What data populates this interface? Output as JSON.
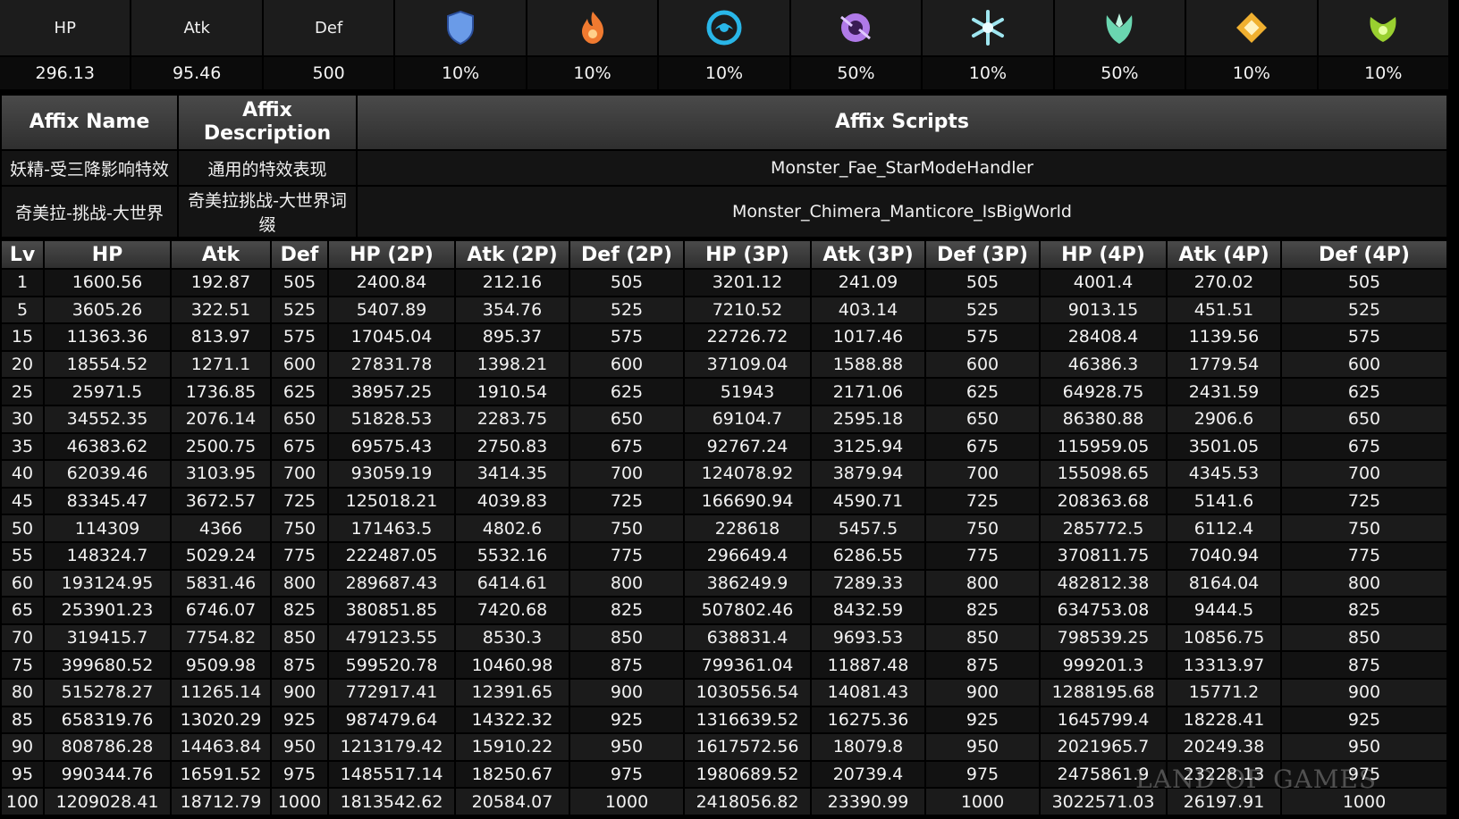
{
  "stats": [
    {
      "label": "HP",
      "value": "296.13"
    },
    {
      "label": "Atk",
      "value": "95.46"
    },
    {
      "label": "Def",
      "value": "500"
    },
    {
      "icon": "physical-shield-icon",
      "value": "10%",
      "color": "#6a9be8"
    },
    {
      "icon": "pyro-icon",
      "value": "10%",
      "color": "#f07a30"
    },
    {
      "icon": "hydro-icon",
      "value": "10%",
      "color": "#29b6e8"
    },
    {
      "icon": "electro-icon",
      "value": "50%",
      "color": "#b07ae8"
    },
    {
      "icon": "cryo-icon",
      "value": "10%",
      "color": "#9fe6f0"
    },
    {
      "icon": "anemo-icon",
      "value": "50%",
      "color": "#6ad6b0"
    },
    {
      "icon": "geo-icon",
      "value": "10%",
      "color": "#f0b030"
    },
    {
      "icon": "dendro-icon",
      "value": "10%",
      "color": "#9ad030"
    }
  ],
  "affix": {
    "headers": [
      "Affix Name",
      "Affix Description",
      "Affix Scripts"
    ],
    "rows": [
      [
        "妖精-受三降影响特效",
        "通用的特效表现",
        "Monster_Fae_StarModeHandler"
      ],
      [
        "奇美拉-挑战-大世界",
        "奇美拉挑战-大世界词缀",
        "Monster_Chimera_Manticore_IsBigWorld"
      ]
    ]
  },
  "levels": {
    "headers": [
      "Lv",
      "HP",
      "Atk",
      "Def",
      "HP (2P)",
      "Atk (2P)",
      "Def (2P)",
      "HP (3P)",
      "Atk (3P)",
      "Def (3P)",
      "HP (4P)",
      "Atk (4P)",
      "Def (4P)"
    ],
    "rows": [
      [
        "1",
        "1600.56",
        "192.87",
        "505",
        "2400.84",
        "212.16",
        "505",
        "3201.12",
        "241.09",
        "505",
        "4001.4",
        "270.02",
        "505"
      ],
      [
        "5",
        "3605.26",
        "322.51",
        "525",
        "5407.89",
        "354.76",
        "525",
        "7210.52",
        "403.14",
        "525",
        "9013.15",
        "451.51",
        "525"
      ],
      [
        "15",
        "11363.36",
        "813.97",
        "575",
        "17045.04",
        "895.37",
        "575",
        "22726.72",
        "1017.46",
        "575",
        "28408.4",
        "1139.56",
        "575"
      ],
      [
        "20",
        "18554.52",
        "1271.1",
        "600",
        "27831.78",
        "1398.21",
        "600",
        "37109.04",
        "1588.88",
        "600",
        "46386.3",
        "1779.54",
        "600"
      ],
      [
        "25",
        "25971.5",
        "1736.85",
        "625",
        "38957.25",
        "1910.54",
        "625",
        "51943",
        "2171.06",
        "625",
        "64928.75",
        "2431.59",
        "625"
      ],
      [
        "30",
        "34552.35",
        "2076.14",
        "650",
        "51828.53",
        "2283.75",
        "650",
        "69104.7",
        "2595.18",
        "650",
        "86380.88",
        "2906.6",
        "650"
      ],
      [
        "35",
        "46383.62",
        "2500.75",
        "675",
        "69575.43",
        "2750.83",
        "675",
        "92767.24",
        "3125.94",
        "675",
        "115959.05",
        "3501.05",
        "675"
      ],
      [
        "40",
        "62039.46",
        "3103.95",
        "700",
        "93059.19",
        "3414.35",
        "700",
        "124078.92",
        "3879.94",
        "700",
        "155098.65",
        "4345.53",
        "700"
      ],
      [
        "45",
        "83345.47",
        "3672.57",
        "725",
        "125018.21",
        "4039.83",
        "725",
        "166690.94",
        "4590.71",
        "725",
        "208363.68",
        "5141.6",
        "725"
      ],
      [
        "50",
        "114309",
        "4366",
        "750",
        "171463.5",
        "4802.6",
        "750",
        "228618",
        "5457.5",
        "750",
        "285772.5",
        "6112.4",
        "750"
      ],
      [
        "55",
        "148324.7",
        "5029.24",
        "775",
        "222487.05",
        "5532.16",
        "775",
        "296649.4",
        "6286.55",
        "775",
        "370811.75",
        "7040.94",
        "775"
      ],
      [
        "60",
        "193124.95",
        "5831.46",
        "800",
        "289687.43",
        "6414.61",
        "800",
        "386249.9",
        "7289.33",
        "800",
        "482812.38",
        "8164.04",
        "800"
      ],
      [
        "65",
        "253901.23",
        "6746.07",
        "825",
        "380851.85",
        "7420.68",
        "825",
        "507802.46",
        "8432.59",
        "825",
        "634753.08",
        "9444.5",
        "825"
      ],
      [
        "70",
        "319415.7",
        "7754.82",
        "850",
        "479123.55",
        "8530.3",
        "850",
        "638831.4",
        "9693.53",
        "850",
        "798539.25",
        "10856.75",
        "850"
      ],
      [
        "75",
        "399680.52",
        "9509.98",
        "875",
        "599520.78",
        "10460.98",
        "875",
        "799361.04",
        "11887.48",
        "875",
        "999201.3",
        "13313.97",
        "875"
      ],
      [
        "80",
        "515278.27",
        "11265.14",
        "900",
        "772917.41",
        "12391.65",
        "900",
        "1030556.54",
        "14081.43",
        "900",
        "1288195.68",
        "15771.2",
        "900"
      ],
      [
        "85",
        "658319.76",
        "13020.29",
        "925",
        "987479.64",
        "14322.32",
        "925",
        "1316639.52",
        "16275.36",
        "925",
        "1645799.4",
        "18228.41",
        "925"
      ],
      [
        "90",
        "808786.28",
        "14463.84",
        "950",
        "1213179.42",
        "15910.22",
        "950",
        "1617572.56",
        "18079.8",
        "950",
        "2021965.7",
        "20249.38",
        "950"
      ],
      [
        "95",
        "990344.76",
        "16591.52",
        "975",
        "1485517.14",
        "18250.67",
        "975",
        "1980689.52",
        "20739.4",
        "975",
        "2475861.9",
        "23228.13",
        "975"
      ],
      [
        "100",
        "1209028.41",
        "18712.79",
        "1000",
        "1813542.62",
        "20584.07",
        "1000",
        "2418056.82",
        "23390.99",
        "1000",
        "3022571.03",
        "26197.91",
        "1000"
      ]
    ]
  },
  "watermark": "LAND OF GAMES"
}
